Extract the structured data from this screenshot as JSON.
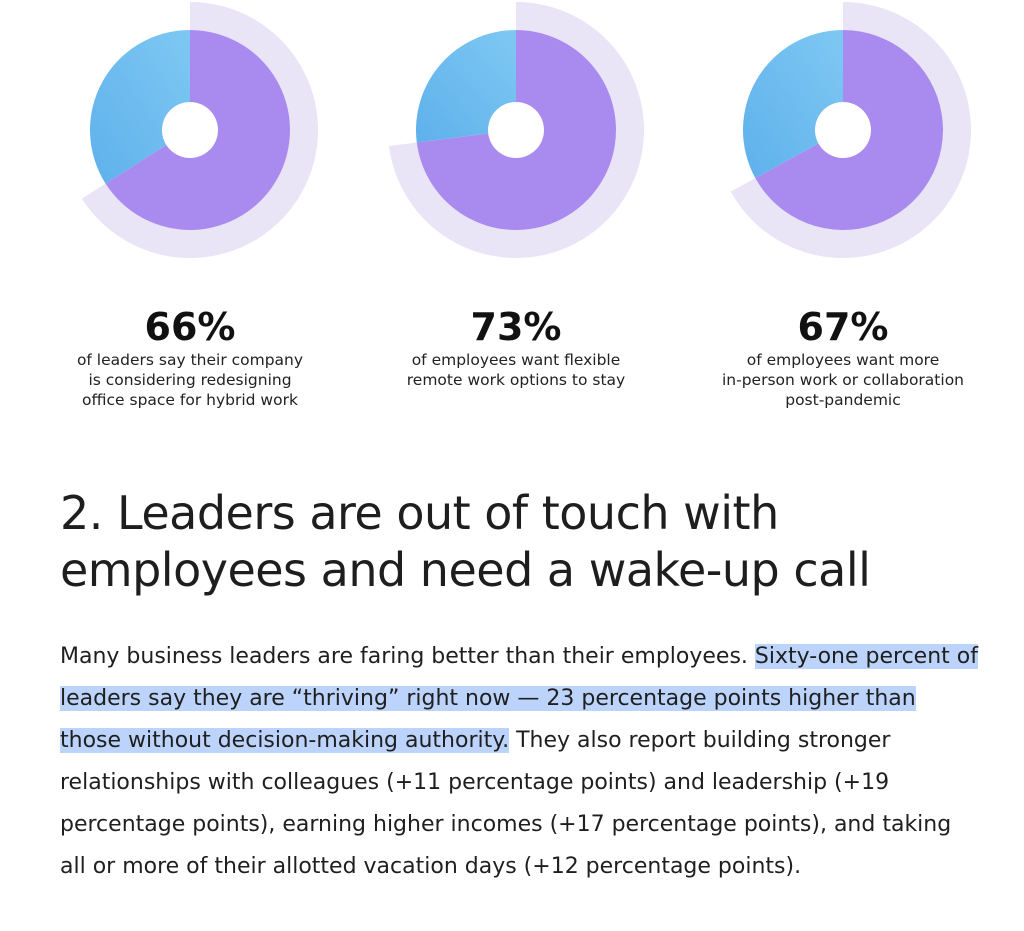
{
  "chart_data": [
    {
      "type": "pie",
      "value_percent": 66,
      "title": "66%",
      "caption": [
        "of leaders say their company",
        "is considering redesigning",
        "office space for hybrid work"
      ],
      "colors": {
        "fill": "#a98bf0",
        "rest": "#7ec8f2",
        "halo": "#e9e4f6"
      }
    },
    {
      "type": "pie",
      "value_percent": 73,
      "title": "73%",
      "caption": [
        "of employees want flexible",
        "remote work options to stay"
      ],
      "colors": {
        "fill": "#a98bf0",
        "rest": "#7ec8f2",
        "halo": "#e9e4f6"
      }
    },
    {
      "type": "pie",
      "value_percent": 67,
      "title": "67%",
      "caption": [
        "of employees want more",
        "in-person work or collaboration",
        "post-pandemic"
      ],
      "colors": {
        "fill": "#a98bf0",
        "rest": "#7ec8f2",
        "halo": "#e9e4f6"
      }
    }
  ],
  "article": {
    "heading": "2. Leaders are out of touch with employees and need a wake-up call",
    "paragraph": {
      "before": "Many business leaders are faring better than their employees. ",
      "highlighted": "Sixty-one percent of leaders say they are “thriving” right now — 23 percentage points higher than those without decision-making authority.",
      "after": " They also report building stronger relationships with colleagues (+11 percentage points) and leadership (+19 percentage points), earning higher incomes (+17 percentage points), and taking all or more of their allotted vacation days (+12 percentage points)."
    }
  },
  "colors": {
    "highlight": "#bcd4fb",
    "text": "#1f1f1f"
  }
}
